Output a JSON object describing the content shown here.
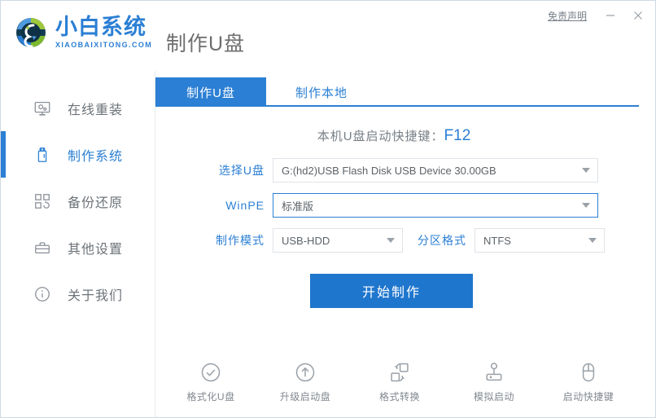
{
  "window": {
    "accent_color": "#2b7fd4",
    "button_color": "#1f76cd",
    "header_title": "制作U盘",
    "disclaimer_label": "免责声明",
    "minimize_label": "最小化",
    "close_label": "关闭"
  },
  "brand": {
    "name_cn": "小白系统",
    "name_en": "XIAOBAIXITONG.COM",
    "logo_icon": "recycle-circle-logo"
  },
  "sidebar": {
    "items": [
      {
        "label": "在线重装",
        "icon": "monitor-icon",
        "active": false
      },
      {
        "label": "制作系统",
        "icon": "usb-drive-icon",
        "active": true
      },
      {
        "label": "备份还原",
        "icon": "blocks-sync-icon",
        "active": false
      },
      {
        "label": "其他设置",
        "icon": "toolbox-icon",
        "active": false
      },
      {
        "label": "关于我们",
        "icon": "info-circle-icon",
        "active": false
      }
    ]
  },
  "main": {
    "tabs": [
      {
        "label": "制作U盘",
        "active": true
      },
      {
        "label": "制作本地",
        "active": false
      }
    ],
    "hotkey": {
      "text": "本机U盘启动快捷键：",
      "key": "F12"
    },
    "form": [
      {
        "label": "选择U盘",
        "value": "G:(hd2)USB Flash Disk USB Device 30.00GB",
        "focused": false
      },
      {
        "label": "WinPE",
        "value": "标准版",
        "focused": true
      }
    ],
    "mode_row": {
      "mode_label": "制作模式",
      "mode_value": "USB-HDD",
      "format_label": "分区格式",
      "format_value": "NTFS"
    },
    "start_button": "开始制作"
  },
  "toolbar": {
    "items": [
      {
        "label": "格式化U盘",
        "icon": "check-circle-icon"
      },
      {
        "label": "升级启动盘",
        "icon": "arrow-up-circle-icon"
      },
      {
        "label": "格式转换",
        "icon": "convert-squares-icon"
      },
      {
        "label": "模拟启动",
        "icon": "joystick-icon"
      },
      {
        "label": "启动快捷键",
        "icon": "mouse-icon"
      }
    ]
  }
}
